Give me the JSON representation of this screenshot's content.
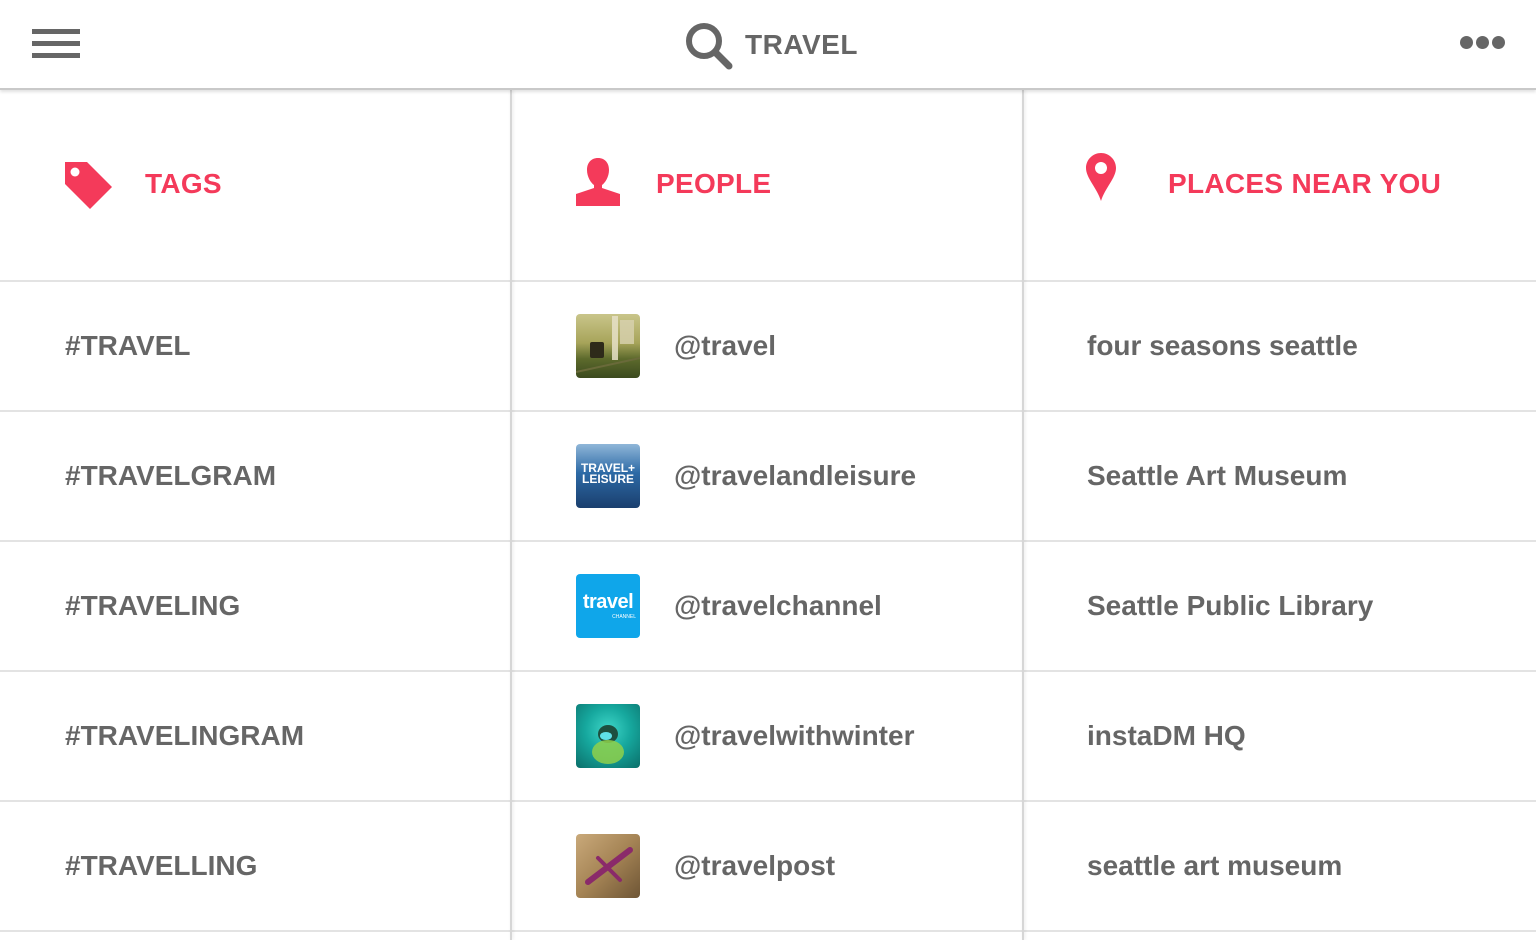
{
  "header": {
    "search_query": "TRAVEL"
  },
  "columns": {
    "tags": {
      "title": "TAGS",
      "icon": "tag-icon",
      "items": [
        "#TRAVEL",
        "#TRAVELGRAM",
        "#TRAVELING",
        "#TRAVELINGRAM",
        "#TRAVELLING"
      ]
    },
    "people": {
      "title": "PEOPLE",
      "icon": "person-icon",
      "items": [
        {
          "handle": "@travel",
          "avatar": "photo-avatar"
        },
        {
          "handle": "@travelandleisure",
          "avatar": "travel-leisure-logo",
          "avatar_text": "TRAVEL+\nLEISURE"
        },
        {
          "handle": "@travelchannel",
          "avatar": "travel-channel-logo",
          "avatar_text": "travel",
          "avatar_subtext": "CHANNEL"
        },
        {
          "handle": "@travelwithwinter",
          "avatar": "underwater-photo-avatar"
        },
        {
          "handle": "@travelpost",
          "avatar": "airplane-photo-avatar"
        }
      ]
    },
    "places": {
      "title": "PLACES NEAR YOU",
      "icon": "location-pin-icon",
      "items": [
        "four seasons seattle",
        "Seattle Art Museum",
        "Seattle Public Library",
        "instaDM HQ",
        "seattle art museum"
      ]
    }
  },
  "colors": {
    "accent": "#f43a5a",
    "text": "#666666",
    "divider": "#e3e3e3"
  }
}
